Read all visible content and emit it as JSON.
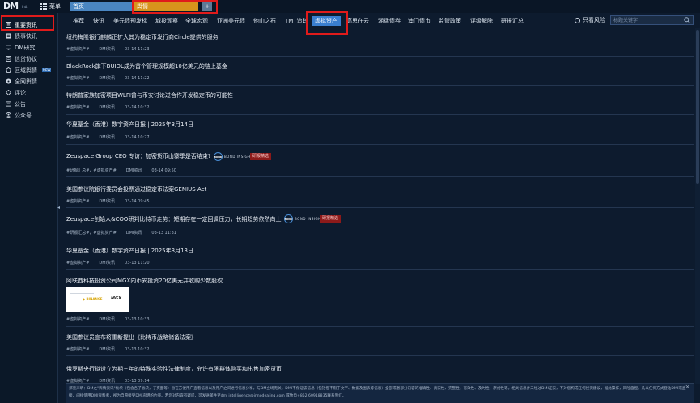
{
  "header": {
    "logo_text": "DM",
    "logo_sub": "Intl.",
    "menu_label": "菜单",
    "tabs": [
      {
        "label": "首页"
      },
      {
        "label": "舆情"
      },
      {
        "label": "+"
      }
    ]
  },
  "sidebar": {
    "items": [
      {
        "label": "重要资讯",
        "icon": "news-icon"
      },
      {
        "label": "债事快讯",
        "icon": "flash-icon"
      },
      {
        "label": "DM研究",
        "icon": "research-icon"
      },
      {
        "label": "信贷协议",
        "icon": "document-icon"
      },
      {
        "label": "区域舆情",
        "icon": "region-icon",
        "badge": "NEW"
      },
      {
        "label": "全网舆情",
        "icon": "globe-icon"
      },
      {
        "label": "评论",
        "icon": "comment-icon"
      },
      {
        "label": "公告",
        "icon": "announcement-icon"
      },
      {
        "label": "公众号",
        "icon": "account-icon"
      }
    ]
  },
  "categories": [
    {
      "label": "推荐"
    },
    {
      "label": "快讯"
    },
    {
      "label": "美元债预发标"
    },
    {
      "label": "城投观察"
    },
    {
      "label": "全球宏观"
    },
    {
      "label": "亚洲美元债"
    },
    {
      "label": "他山之石"
    },
    {
      "label": "TMT追踪"
    },
    {
      "label": "虚拟资产"
    },
    {
      "label": "高思在云"
    },
    {
      "label": "湘猛债券"
    },
    {
      "label": "澳门债市"
    },
    {
      "label": "监管政策"
    },
    {
      "label": "评级解除"
    },
    {
      "label": "研报汇总"
    }
  ],
  "only_risk_label": "只看风险",
  "search": {
    "placeholder": "标题关键字"
  },
  "feed": [
    {
      "title": "纽约梅隆银行麒麟正扩大其为稳定币发行商Circle提供的服务",
      "tags": "#虚拟资产#",
      "source": "DMI资讯",
      "time": "03-14 11:23"
    },
    {
      "title": "BlackRock旗下BUIDL成为首个管理规模超10亿美元的链上基金",
      "tags": "#虚拟资产#",
      "source": "DMI资讯",
      "time": "03-14 11:22"
    },
    {
      "title": "特朗普家族加密项目WLFI曾与币安讨论过合作开发稳定币的可能性",
      "tags": "#虚拟资产#",
      "source": "DMI资讯",
      "time": "03-14 10:32"
    },
    {
      "title": "华夏基金（香港）数字资产日报 | 2025年3月14日",
      "tags": "#虚拟资产#",
      "source": "DMI资讯",
      "time": "03-14 10:27"
    },
    {
      "title": "Zeuspace Group CEO 专访：加密货币山寨季是否结束?",
      "tags": "#研报汇总#，#虚拟资产#",
      "source": "DMI资讯",
      "time": "03-14 09:50",
      "brand": "BOND INSIGHT",
      "brand_short": "BOND",
      "badge": "研报精选"
    },
    {
      "title": "美国参议院银行委员会投票通过稳定币法案GENIUS Act",
      "tags": "#虚拟资产#",
      "source": "DMI资讯",
      "time": "03-14 09:45"
    },
    {
      "title": "Zeuspace创始人&COO研判比特币走势：短期存在一定回调压力，长期趋势依然向上",
      "tags": "#研报汇总#，#虚拟资产#",
      "source": "DMI资讯",
      "time": "03-13 11:31",
      "brand": "BOND INSIGHT",
      "brand_short": "BOND",
      "badge": "研报精选"
    },
    {
      "title": "华夏基金（香港）数字资产日报 | 2025年3月13日",
      "tags": "#虚拟资产#",
      "source": "DMI资讯",
      "time": "03-13 11:20"
    },
    {
      "title": "阿联酋科技投资公司MGX向币安投资20亿美元并收购少数股权",
      "tags": "#虚拟资产#",
      "source": "DMI资讯",
      "time": "03-13 10:33",
      "thumb_brand": "◆ BINANCE",
      "thumb_brand2": "MGX"
    },
    {
      "title": "美国参议员宣布将重新提出《比特币战略储备法案》",
      "tags": "#虚拟资产#",
      "source": "DMI资讯",
      "time": "03-13 10:32"
    },
    {
      "title": "俄罗斯央行拟设立为期三年的特殊实验性法律制度，允许有限群体购买和出售加密货币",
      "tags": "#虚拟资产#",
      "source": "DMI资讯",
      "time": "03-13 09:14"
    }
  ],
  "disclaimer": "郑重声明：DM之\"舆情资讯\"板块（包含各子板块，子页面等）旨在方便用户查看信息以及用户之间进行信息分享，与DM立场无关。DMI不保证该信息（包括但不限于文字、数据及图表等信息）全部或者部分内容的准确性、真实性、完整性、有效性、及时性、原创性等。相关信息并未经过DMI证实，不对您构成任何投资建议，据此操作，风险自担。凡以任何方式登陆DMI或直接、间接使用DMI资料者，视为自愿接受DMI声明的约束。若您对内容有疑问，可发送邮件至dm_intelligence@innodealing.com 或致电+852 60918835联系我们。",
  "disclaimer_close": "×",
  "colors": {
    "active_category": "#3a7fd0",
    "home_tab": "#4a86c2",
    "yuqing_tab": "#d8941c",
    "highlight": "#e01b1b",
    "badge_red": "#8c1a1a"
  }
}
